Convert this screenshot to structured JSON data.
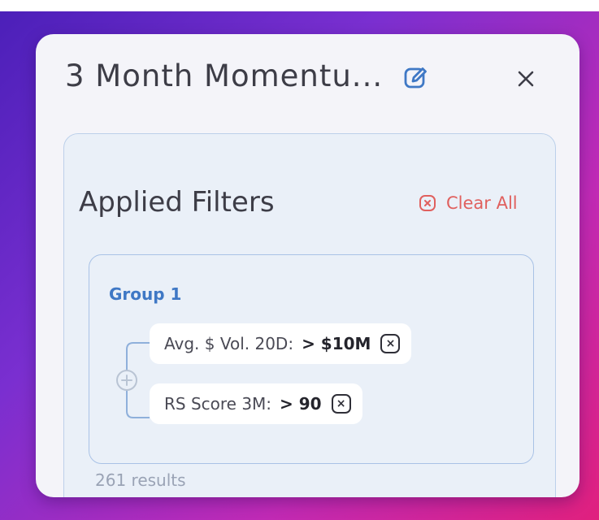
{
  "panel": {
    "title": "3 Month Momentu...",
    "edit_icon": "edit-pencil-icon",
    "close_icon": "close-icon",
    "close_label": "✕"
  },
  "filters": {
    "heading": "Applied Filters",
    "clear_all_label": "Clear All",
    "clear_all_icon": "clear-circle-x-icon"
  },
  "group": {
    "title": "Group 1",
    "connector_icon": "plus-circle-icon",
    "rules": [
      {
        "label": "Avg. $ Vol. 20D:",
        "value": "> $10M",
        "remove": "×"
      },
      {
        "label": "RS Score 3M:",
        "value": "> 90",
        "remove": "×"
      }
    ]
  },
  "results_text": "261 results",
  "colors": {
    "accent_blue": "#3f78c5",
    "clear_red": "#e0605e",
    "panel_bg": "#f4f4f9",
    "filters_bg": "#eaf0f8"
  }
}
